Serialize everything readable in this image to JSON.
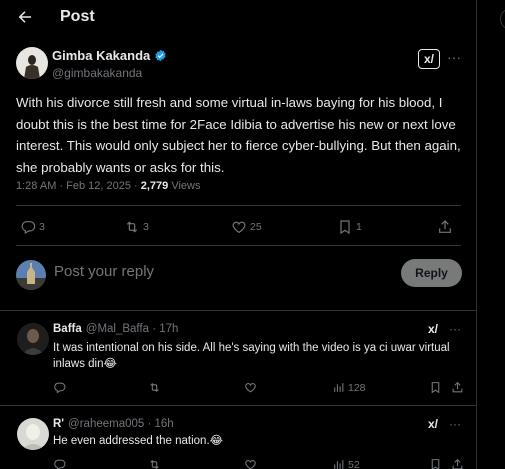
{
  "header": {
    "title": "Post"
  },
  "post": {
    "author_name": "Gimba Kakanda",
    "author_handle": "@gimbakakanda",
    "grok_label": "x/",
    "more": "···",
    "text": "With his divorce still fresh and some virtual in-laws baying for his blood, I doubt this is the best time for 2Face Idibia to advertise his new or next love interest. This would only subject her to fierce cyber-bullying. But then again, she probably wants or asks for this.",
    "time": "1:28 AM · Feb 12, 2025 · ",
    "views_count": "2,779",
    "views_label": " Views",
    "actions": {
      "replies": "3",
      "reposts": "3",
      "likes": "25",
      "bookmarks": "1"
    }
  },
  "compose": {
    "placeholder": "Post your reply",
    "button_label": "Reply"
  },
  "replies": [
    {
      "name": "Baffa",
      "handle": "@Mal_Baffa · 17h",
      "text": "It was intentional on his side. All he's saying with the video is ya ci uwar virtual inlaws din😂",
      "views": "128"
    },
    {
      "name": "R'",
      "handle": "@raheema005 · 16h",
      "text": "He even addressed the nation.😂",
      "views": "52"
    }
  ],
  "colors": {
    "background": "#000000",
    "text": "#e7e9ea",
    "muted": "#71767b",
    "border": "#2f3336",
    "verified": "#1d9bf0",
    "reply_button": "#787a7a"
  }
}
